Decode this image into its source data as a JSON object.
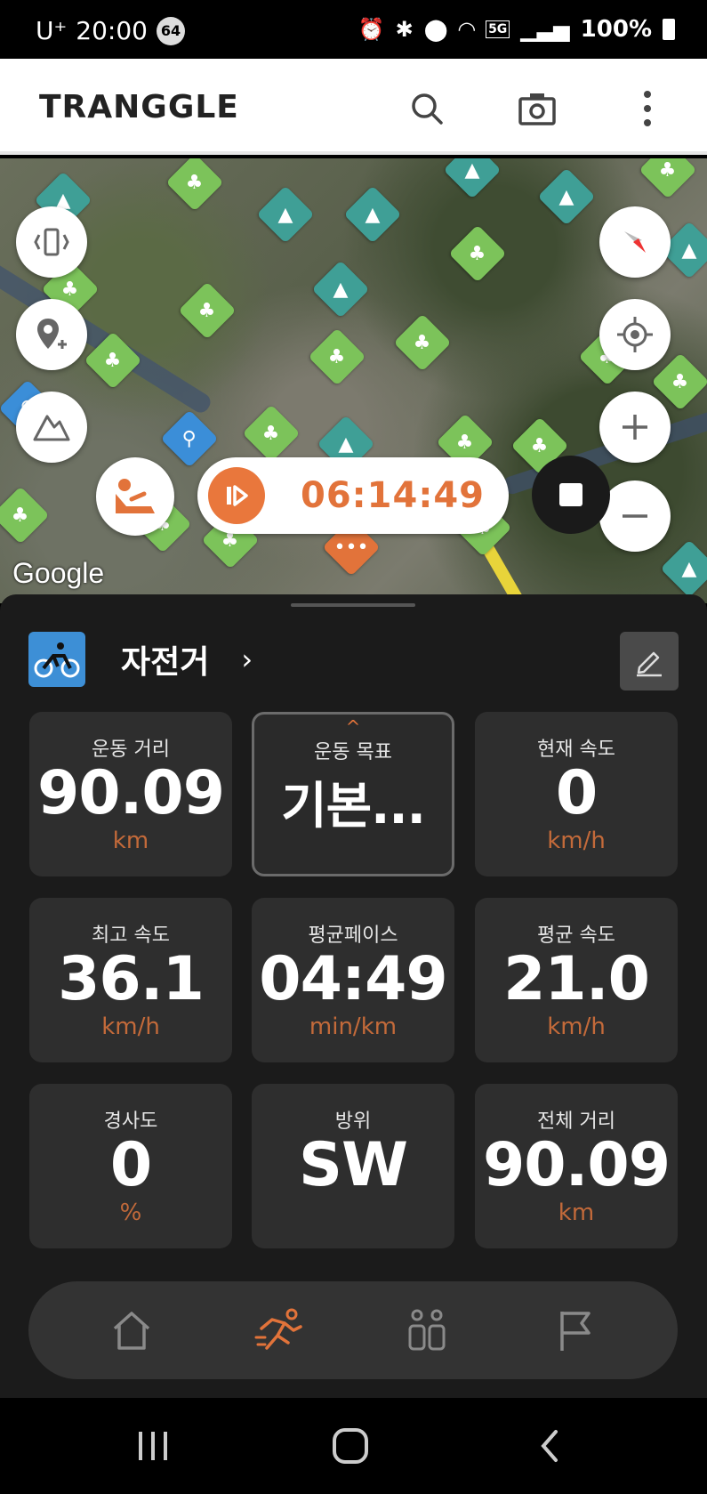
{
  "status_bar": {
    "carrier": "U⁺",
    "time": "20:00",
    "badge": "64",
    "network": "5G",
    "battery": "100%"
  },
  "app_bar": {
    "logo": "TRANGGLE",
    "search_icon": "search-icon",
    "camera_icon": "camera-icon",
    "more_icon": "more-vert-icon"
  },
  "map": {
    "google_label": "Google",
    "timer": "06:14:49"
  },
  "activity": {
    "name": "자전거",
    "arrow": "›"
  },
  "stats": [
    {
      "label": "운동 거리",
      "value": "90.09",
      "unit": "km"
    },
    {
      "label": "운동 목표",
      "value": "기본...",
      "unit": "",
      "caret": "^"
    },
    {
      "label": "현재 속도",
      "value": "0",
      "unit": "km/h"
    },
    {
      "label": "최고 속도",
      "value": "36.1",
      "unit": "km/h"
    },
    {
      "label": "평균페이스",
      "value": "04:49",
      "unit": "min/km"
    },
    {
      "label": "평균 속도",
      "value": "21.0",
      "unit": "km/h"
    },
    {
      "label": "경사도",
      "value": "0",
      "unit": "%"
    },
    {
      "label": "방위",
      "value": "SW",
      "unit": ""
    },
    {
      "label": "전체 거리",
      "value": "90.09",
      "unit": "km"
    }
  ],
  "colors": {
    "accent": "#e2733a",
    "panel": "#1b1b1b",
    "card": "#2e2e2e"
  }
}
